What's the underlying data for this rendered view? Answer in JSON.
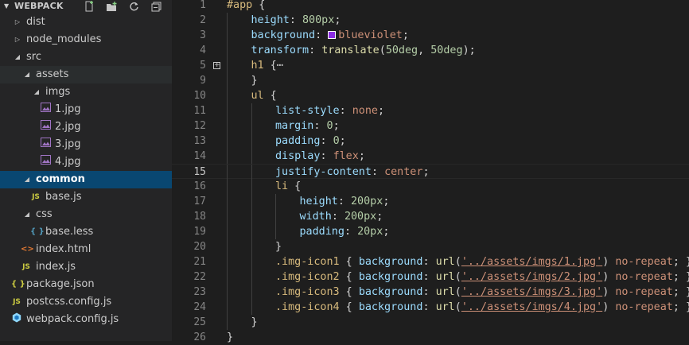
{
  "sidebar": {
    "title": "WEBPACK",
    "actions": [
      "new-file-icon",
      "new-folder-icon",
      "refresh-icon",
      "collapse-all-icon"
    ],
    "tree": [
      {
        "label": "dist",
        "icon": "chevron-right-icon",
        "depth": 0,
        "expanded": false
      },
      {
        "label": "node_modules",
        "icon": "chevron-right-icon",
        "depth": 0,
        "expanded": false
      },
      {
        "label": "src",
        "icon": "chevron-down-icon",
        "depth": 0,
        "expanded": true
      },
      {
        "label": "assets",
        "icon": "chevron-down-icon",
        "depth": 1,
        "expanded": true
      },
      {
        "label": "imgs",
        "icon": "chevron-down-icon",
        "depth": 2,
        "expanded": true
      },
      {
        "label": "1.jpg",
        "icon": "image-file-icon",
        "depth": 3
      },
      {
        "label": "2.jpg",
        "icon": "image-file-icon",
        "depth": 3
      },
      {
        "label": "3.jpg",
        "icon": "image-file-icon",
        "depth": 3
      },
      {
        "label": "4.jpg",
        "icon": "image-file-icon",
        "depth": 3
      },
      {
        "label": "common",
        "icon": "chevron-down-icon",
        "depth": 1,
        "expanded": true,
        "selected": true
      },
      {
        "label": "base.js",
        "icon": "js-file-icon",
        "depth": 2,
        "badge": "JS"
      },
      {
        "label": "css",
        "icon": "chevron-down-icon",
        "depth": 1,
        "expanded": true
      },
      {
        "label": "base.less",
        "icon": "less-file-icon",
        "depth": 2,
        "badge": "{ }"
      },
      {
        "label": "index.html",
        "icon": "html-file-icon",
        "depth": 1,
        "badge": "<>"
      },
      {
        "label": "index.js",
        "icon": "js-file-icon",
        "depth": 1,
        "badge": "JS"
      },
      {
        "label": "package.json",
        "icon": "json-file-icon",
        "depth": 0,
        "badge": "{ }"
      },
      {
        "label": "postcss.config.js",
        "icon": "js-file-icon",
        "depth": 0,
        "badge": "JS"
      },
      {
        "label": "webpack.config.js",
        "icon": "webpack-file-icon",
        "depth": 0
      }
    ]
  },
  "editor": {
    "current_line": "15",
    "color_swatch": "#8a2be2",
    "lines": [
      {
        "no": "1",
        "text": "#app {"
      },
      {
        "no": "2",
        "text": "height: 800px;"
      },
      {
        "no": "3",
        "text": "background: blueviolet;"
      },
      {
        "no": "4",
        "text": "transform: translate(50deg, 50deg);"
      },
      {
        "no": "5",
        "text": "h1 {⋯"
      },
      {
        "no": "9",
        "text": "}"
      },
      {
        "no": "10",
        "text": "ul {"
      },
      {
        "no": "11",
        "text": "list-style: none;"
      },
      {
        "no": "12",
        "text": "margin: 0;"
      },
      {
        "no": "13",
        "text": "padding: 0;"
      },
      {
        "no": "14",
        "text": "display: flex;"
      },
      {
        "no": "15",
        "text": "justify-content: center;"
      },
      {
        "no": "16",
        "text": "li {"
      },
      {
        "no": "17",
        "text": "height: 200px;"
      },
      {
        "no": "18",
        "text": "width: 200px;"
      },
      {
        "no": "19",
        "text": "padding: 20px;"
      },
      {
        "no": "20",
        "text": "}"
      },
      {
        "no": "21",
        "text": ".img-icon1 { background: url('../assets/imgs/1.jpg') no-repeat; }"
      },
      {
        "no": "22",
        "text": ".img-icon2 { background: url('../assets/imgs/2.jpg') no-repeat; }"
      },
      {
        "no": "23",
        "text": ".img-icon3 { background: url('../assets/imgs/3.jpg') no-repeat; }"
      },
      {
        "no": "24",
        "text": ".img-icon4 { background: url('../assets/imgs/4.jpg') no-repeat; }"
      },
      {
        "no": "25",
        "text": "}"
      },
      {
        "no": "26",
        "text": "}"
      }
    ]
  }
}
